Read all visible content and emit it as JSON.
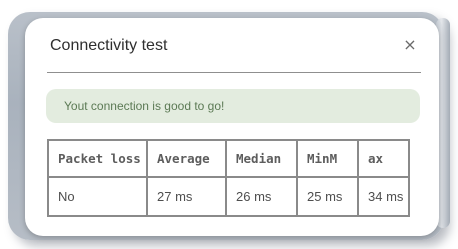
{
  "dialog": {
    "title": "Connectivity test",
    "close_icon": "close-icon",
    "close_glyph": "×"
  },
  "alert": {
    "message": "Yout connection is good to go!",
    "color": "#e3ecdf"
  },
  "table": {
    "headers": [
      "Packet loss",
      "Average",
      "Median",
      "MinM",
      "ax"
    ],
    "rows": [
      [
        "No",
        "27 ms",
        "26 ms",
        "25 ms",
        "34 ms"
      ]
    ]
  }
}
